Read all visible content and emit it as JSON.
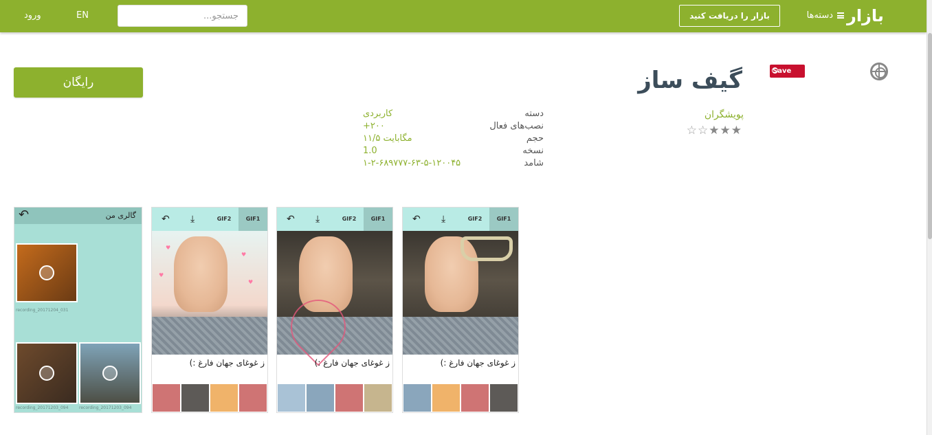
{
  "header": {
    "logo_text": "بازار",
    "categories_label": "دسته‌ها",
    "get_bazaar_label": "بازار را دریافت کنید",
    "search_placeholder": "جستجو...",
    "lang_label": "EN",
    "login_label": "ورود"
  },
  "app": {
    "title": "گیف ساز",
    "save_badge": "Save",
    "install_button": "رایگان",
    "developer": "پویشگران",
    "rating_stars": 3,
    "rating_max": 5
  },
  "details": {
    "labels": [
      "دسته",
      "نصب‌های فعال",
      "حجم",
      "نسخه",
      "شامد"
    ],
    "values": [
      "کاربردی",
      "+۲۰۰",
      "۱۱/۵ مگابایت",
      "1.0",
      "۱-۲-۶۸۹۷۷۷-۶۳-۵-۱۲۰۰۴۵"
    ]
  },
  "screenshots": [
    {
      "tabs": [
        "GIF1",
        "GIF2"
      ],
      "caption": "ز غوغای جهان فارغ :)"
    },
    {
      "tabs": [
        "GIF1",
        "GIF2"
      ],
      "caption": "ز غوغای جهان فارغ :)"
    },
    {
      "tabs": [
        "GIF1",
        "GIF2"
      ],
      "caption": "ز غوغای جهان فارغ :)"
    }
  ],
  "gallery_screenshot": {
    "title": "گالری من",
    "file_labels": [
      "recording_20171204_031",
      "recording_20171203_094",
      "recording_20171203_094"
    ]
  },
  "colors": {
    "brand": "#8db12e",
    "title": "#3c4d5a",
    "save_badge": "#c8102e"
  }
}
